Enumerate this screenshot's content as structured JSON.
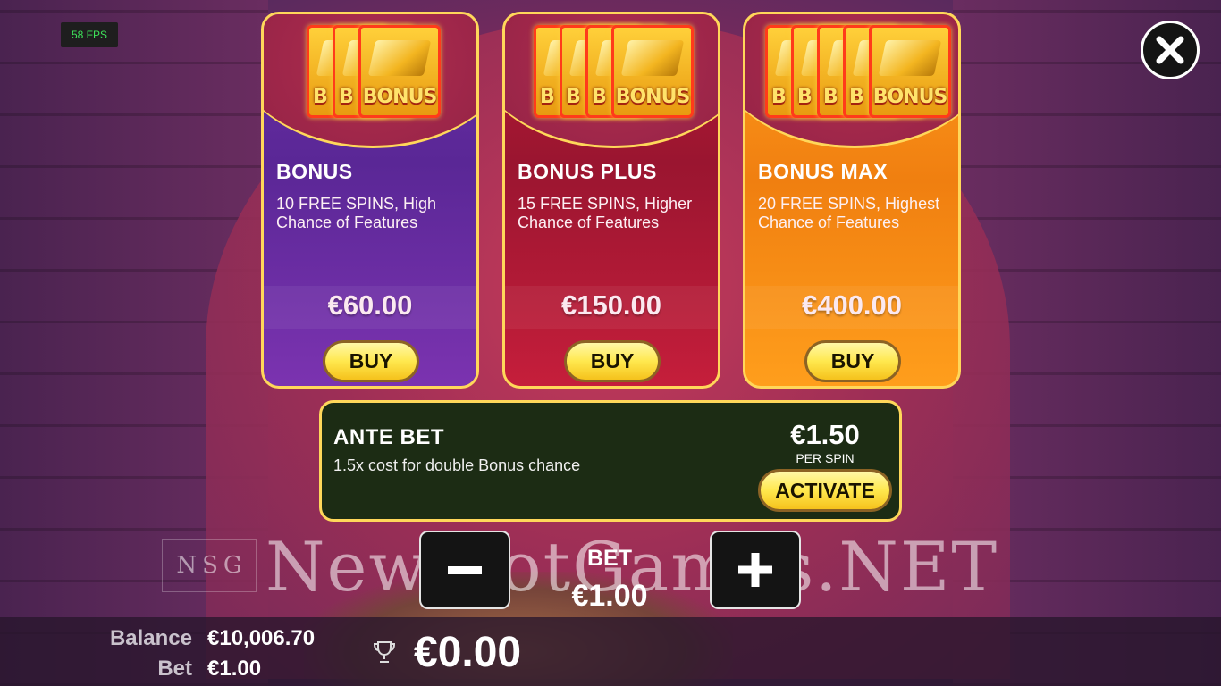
{
  "hud": {
    "fps": "58 FPS"
  },
  "cards": [
    {
      "title": "BONUS",
      "description": "10 FREE SPINS, High Chance of Features",
      "price": "€60.00",
      "buy_label": "BUY",
      "symbol_label": "BONUS",
      "symbol_partial": "B",
      "symbol_count": 3
    },
    {
      "title": "BONUS PLUS",
      "description": "15 FREE SPINS, Higher Chance of Features",
      "price": "€150.00",
      "buy_label": "BUY",
      "symbol_label": "BONUS",
      "symbol_partial": "B",
      "symbol_count": 4
    },
    {
      "title": "BONUS MAX",
      "description": "20 FREE SPINS, Highest Chance of Features",
      "price": "€400.00",
      "buy_label": "BUY",
      "symbol_label": "BONUS",
      "symbol_partial": "B",
      "symbol_count": 5
    }
  ],
  "ante_bet": {
    "title": "ANTE BET",
    "description": "1.5x cost for double Bonus chance",
    "price": "€1.50",
    "per_spin": "PER SPIN",
    "activate_label": "ACTIVATE"
  },
  "bet_control": {
    "label": "BET",
    "value": "€1.00",
    "minus_icon": "minus-icon",
    "plus_icon": "plus-icon"
  },
  "watermark": {
    "logo": [
      "N",
      "S",
      "G"
    ],
    "text": "NewSlotGames.NET"
  },
  "bottom": {
    "balance_label": "Balance",
    "balance_value": "€10,006.70",
    "bet_label": "Bet",
    "bet_value": "€1.00",
    "win_value": "€0.00",
    "win_icon": "trophy-icon"
  },
  "colors": {
    "accent_border": "#ffd75a",
    "button_yellow": "#ffe84e",
    "card_purple": "#6a2fa6",
    "card_red": "#b51b34",
    "card_orange": "#ff9c1d",
    "ante_bg": "#1c2c14"
  }
}
